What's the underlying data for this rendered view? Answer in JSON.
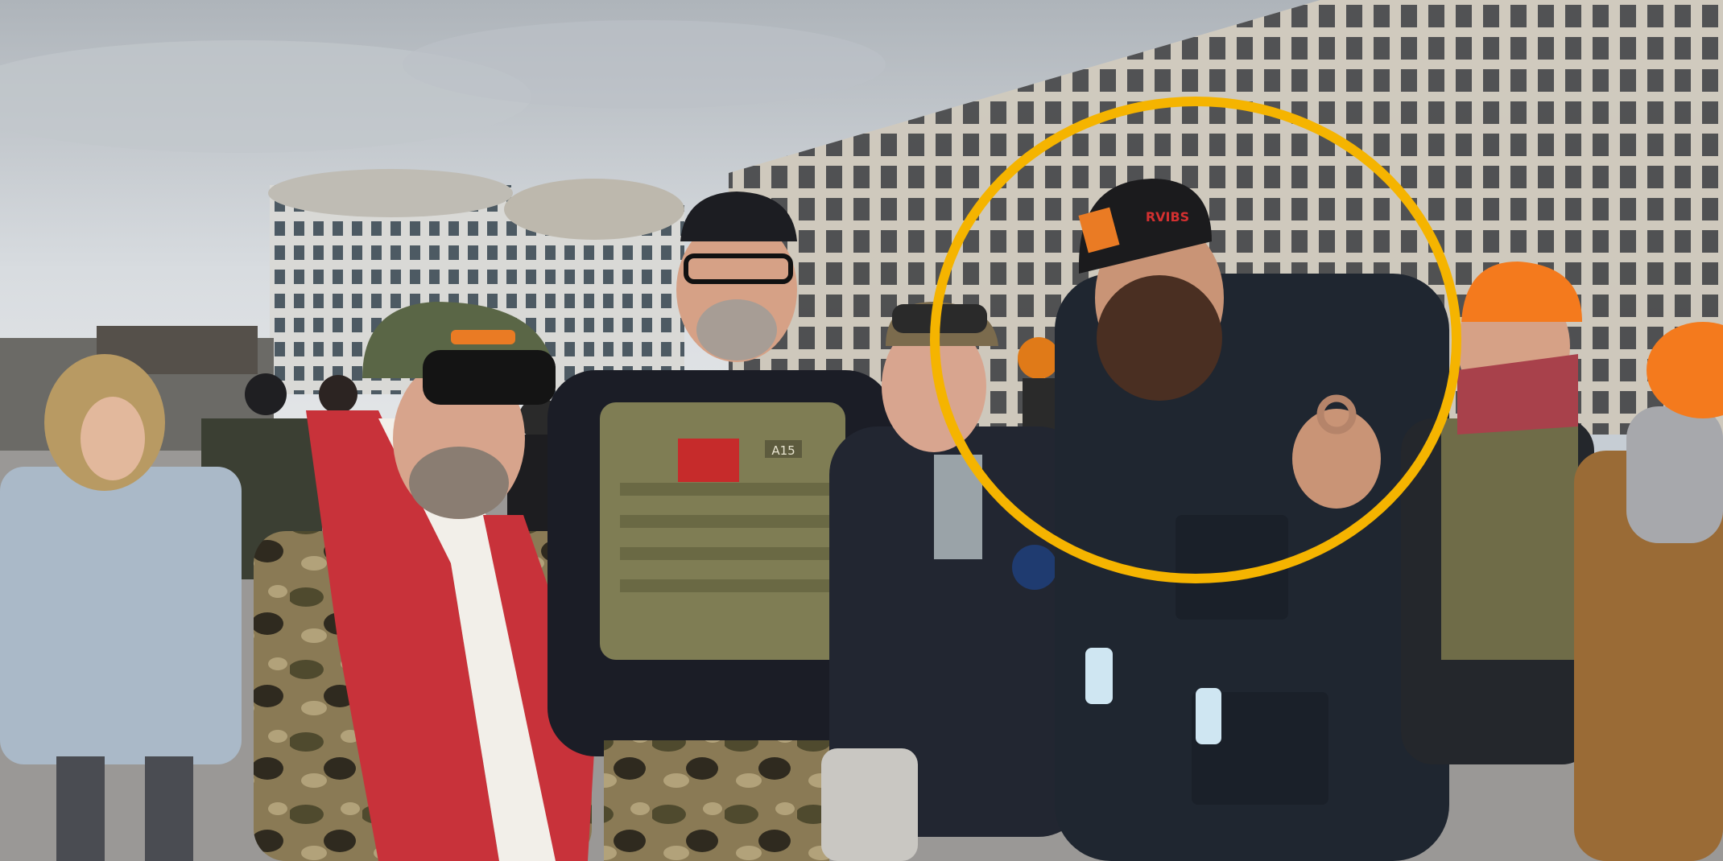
{
  "photo": {
    "cap_text": "RVIBS",
    "vest_tag": "A15",
    "highlight_color": "#f5b400"
  }
}
